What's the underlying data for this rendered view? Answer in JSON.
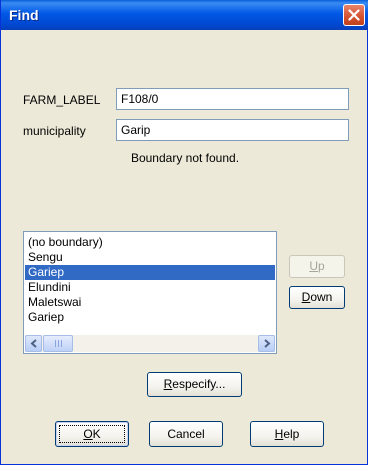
{
  "window": {
    "title": "Find"
  },
  "form": {
    "farm_label": {
      "label": "FARM_LABEL",
      "value": "F108/0"
    },
    "municipality": {
      "label": "municipality",
      "value": "Garip"
    },
    "status": "Boundary not found."
  },
  "list": {
    "items": [
      "(no boundary)",
      "Sengu",
      "Gariep",
      "Elundini",
      "Maletswai",
      "Gariep"
    ],
    "selected_index": 2
  },
  "side_buttons": {
    "up": {
      "mnemonic": "U",
      "rest": "p",
      "enabled": false
    },
    "down": {
      "mnemonic": "D",
      "rest": "own",
      "enabled": true
    }
  },
  "respecify": {
    "mnemonic": "R",
    "rest": "especify..."
  },
  "footer": {
    "ok": {
      "mnemonic": "O",
      "rest": "K"
    },
    "cancel": {
      "label": "Cancel"
    },
    "help": {
      "mnemonic": "H",
      "rest": "elp"
    }
  },
  "icons": {
    "close": "close-icon",
    "scroll_left": "arrow-left-icon",
    "scroll_right": "arrow-right-icon"
  },
  "colors": {
    "titlebar": "#0054e3",
    "selection": "#316ac5",
    "dialog_bg": "#ece9d8"
  }
}
